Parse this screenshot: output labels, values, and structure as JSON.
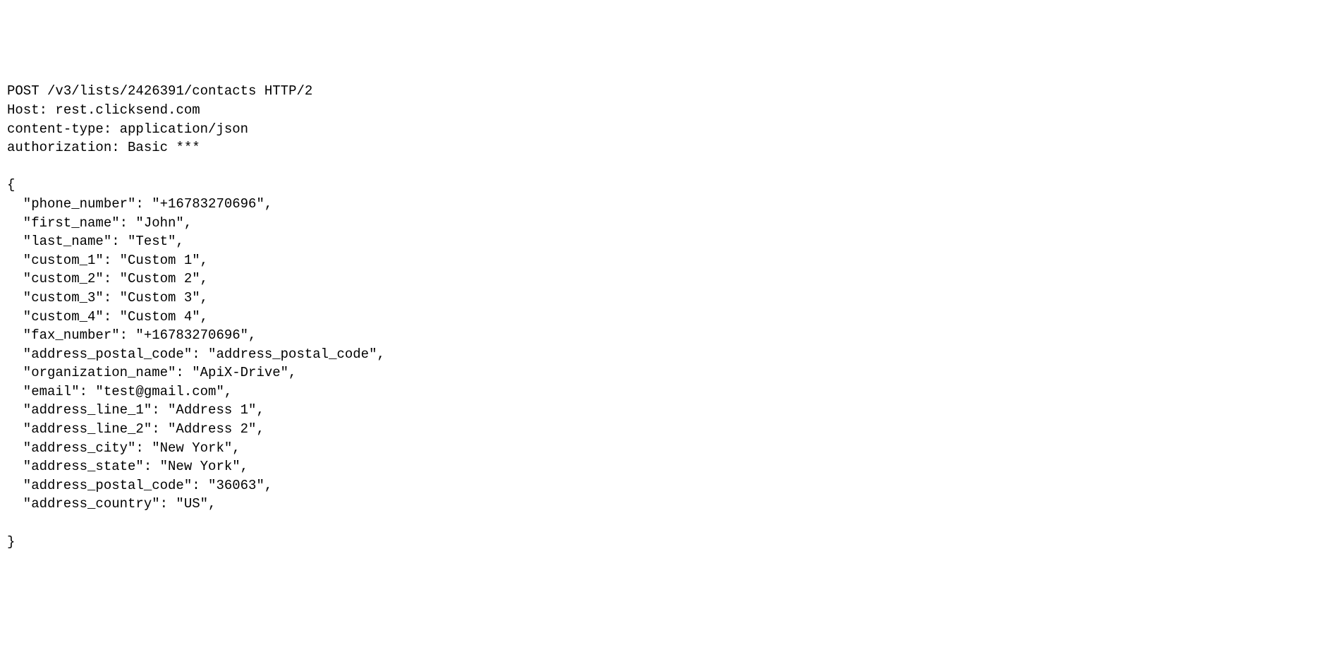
{
  "request": {
    "line1": "POST /v3/lists/2426391/contacts HTTP/2",
    "line2": "Host: rest.clicksend.com",
    "line3": "content-type: application/json",
    "line4": "authorization: Basic ***"
  },
  "body": {
    "open": "{",
    "phone_number": "\"phone_number\": \"+16783270696\",",
    "first_name": "\"first_name\": \"John\",",
    "last_name": "\"last_name\": \"Test\",",
    "custom_1": "\"custom_1\": \"Custom 1\",",
    "custom_2": "\"custom_2\": \"Custom 2\",",
    "custom_3": "\"custom_3\": \"Custom 3\",",
    "custom_4": "\"custom_4\": \"Custom 4\",",
    "fax_number": "\"fax_number\": \"+16783270696\",",
    "address_postal_code_1": "\"address_postal_code\": \"address_postal_code\",",
    "organization_name": "\"organization_name\": \"ApiX-Drive\",",
    "email": "\"email\": \"test@gmail.com\",",
    "address_line_1": "\"address_line_1\": \"Address 1\",",
    "address_line_2": "\"address_line_2\": \"Address 2\",",
    "address_city": "\"address_city\": \"New York\",",
    "address_state": "\"address_state\": \"New York\",",
    "address_postal_code_2": "\"address_postal_code\": \"36063\",",
    "address_country": "\"address_country\": \"US\",",
    "close": "}"
  }
}
